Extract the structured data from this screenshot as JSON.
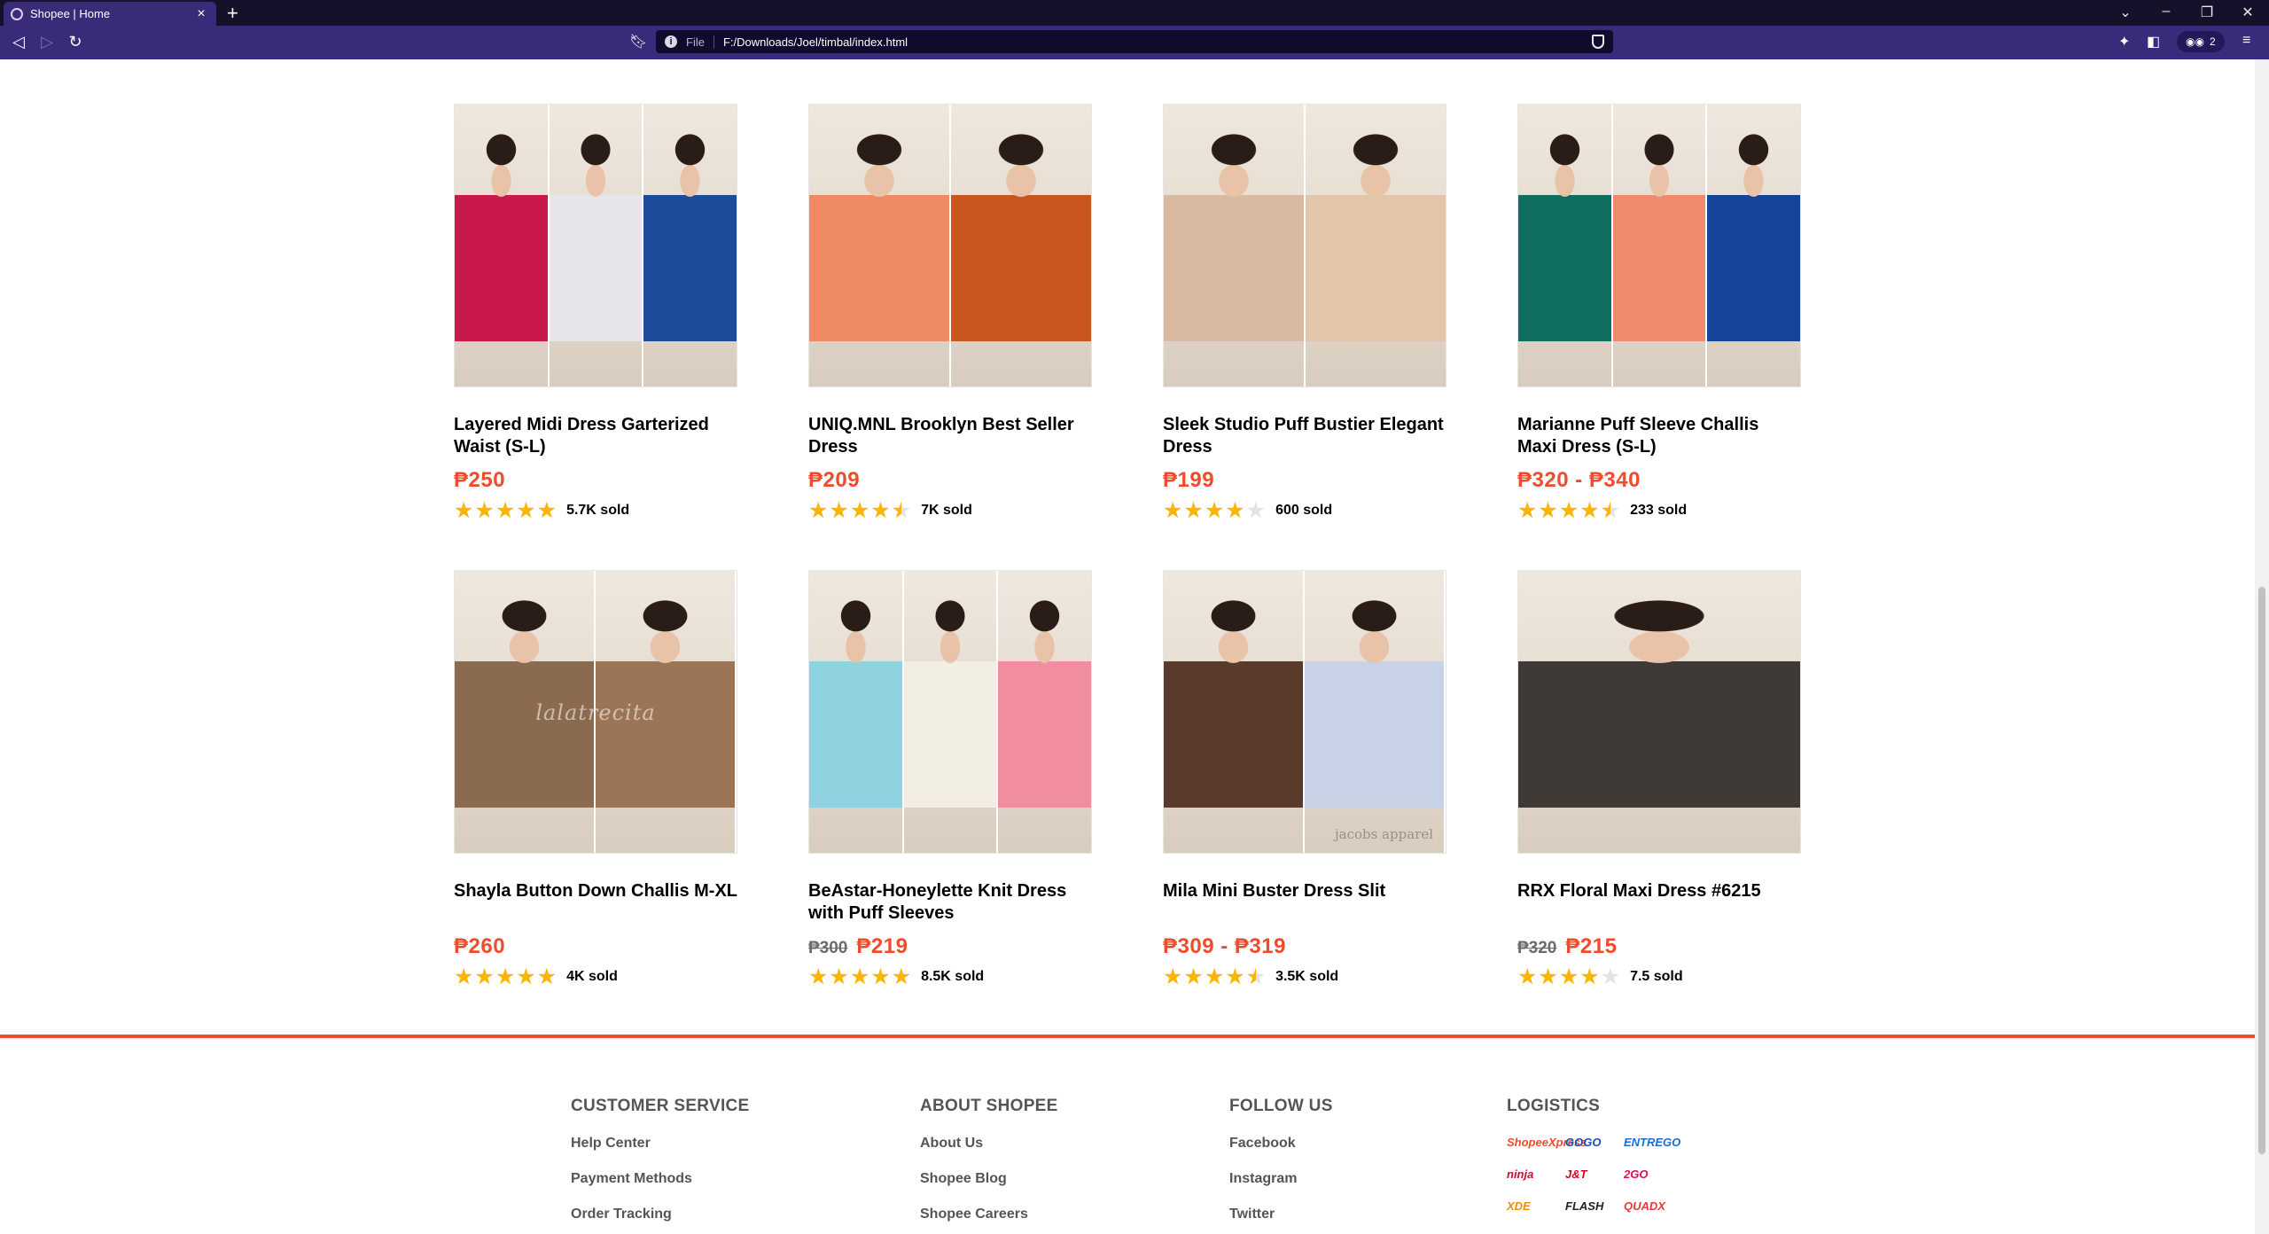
{
  "browser": {
    "tab_title": "Shopee | Home",
    "url_scheme": "File",
    "url": "F:/Downloads/Joel/timbal/index.html",
    "profile_count": "2"
  },
  "products": [
    {
      "title": "Layered Midi Dress Garterized Waist (S-L)",
      "old_price": "",
      "price": "₱250",
      "rating": 5,
      "sold": "5.7K sold",
      "image": {
        "panels": [
          "#c8194a",
          "#e6e6ea",
          "#1f4c9a"
        ],
        "watermark": "",
        "corner_mark": ""
      }
    },
    {
      "title": "UNIQ.MNL Brooklyn Best Seller Dress",
      "old_price": "",
      "price": "₱209",
      "rating": 4.5,
      "sold": "7K sold",
      "image": {
        "panels": [
          "#f08a64",
          "#c9561f"
        ],
        "watermark": "",
        "corner_mark": ""
      }
    },
    {
      "title": "Sleek Studio Puff Bustier Elegant Dress",
      "old_price": "",
      "price": "₱199",
      "rating": 4,
      "sold": "600 sold",
      "image": {
        "panels": [
          "#d9b9a0",
          "#e3c6aa"
        ],
        "watermark": "",
        "corner_mark": ""
      }
    },
    {
      "title": "Marianne Puff Sleeve Challis Maxi Dress (S-L)",
      "old_price": "",
      "price": "₱320 - ₱340",
      "rating": 4.5,
      "sold": "233 sold",
      "image": {
        "panels": [
          "#0f6e5f",
          "#f08a6e",
          "#17449a"
        ],
        "watermark": "",
        "corner_mark": ""
      }
    },
    {
      "title": "Shayla Button Down Challis M-XL",
      "old_price": "",
      "price": "₱260",
      "rating": 5,
      "sold": "4K sold",
      "image": {
        "panels": [
          "#8b6b50",
          "#9c7557"
        ],
        "watermark": "lalatrecita",
        "corner_mark": ""
      }
    },
    {
      "title": "BeAstar-Honeylette Knit Dress with Puff Sleeves",
      "old_price": "₱300",
      "price": "₱219",
      "rating": 5,
      "sold": "8.5K sold",
      "image": {
        "panels": [
          "#8fd3e0",
          "#f3eee4",
          "#f08ea0"
        ],
        "watermark": "",
        "corner_mark": ""
      }
    },
    {
      "title": "Mila Mini Buster Dress Slit",
      "old_price": "",
      "price": "₱309 - ₱319",
      "rating": 4.5,
      "sold": "3.5K sold",
      "image": {
        "panels": [
          "#5a3a2a",
          "#c7d2e6"
        ],
        "watermark": "",
        "corner_mark": "jacobs apparel"
      }
    },
    {
      "title": "RRX Floral Maxi Dress #6215",
      "old_price": "₱320",
      "price": "₱215",
      "rating": 4,
      "sold": "7.5 sold",
      "image": {
        "panels": [
          "#3f3a36"
        ],
        "watermark": "",
        "corner_mark": ""
      }
    }
  ],
  "footer": {
    "customer_service": {
      "title": "CUSTOMER SERVICE",
      "links": [
        "Help Center",
        "Payment Methods",
        "Order Tracking"
      ]
    },
    "about": {
      "title": "ABOUT SHOPEE",
      "links": [
        "About Us",
        "Shopee Blog",
        "Shopee Careers"
      ]
    },
    "follow": {
      "title": "FOLLOW US",
      "links": [
        "Facebook",
        "Instagram",
        "Twitter"
      ]
    },
    "logistics": {
      "title": "LOGISTICS",
      "logos": [
        {
          "name": "ShopeeXpress",
          "color": "#ee4d2d"
        },
        {
          "name": "GOGO",
          "color": "#1a4fc4"
        },
        {
          "name": "ENTREGO",
          "color": "#1a6fd4"
        },
        {
          "name": "ninja",
          "color": "#c8102e"
        },
        {
          "name": "J&T",
          "color": "#d0021b"
        },
        {
          "name": "2GO",
          "color": "#e30b5c"
        },
        {
          "name": "XDE",
          "color": "#f28c00"
        },
        {
          "name": "FLASH",
          "color": "#222222"
        },
        {
          "name": "QUADX",
          "color": "#e03a3a"
        }
      ]
    }
  },
  "colors": {
    "accent": "#ee4d2d",
    "star": "#ffb400",
    "chrome": "#3a2a7a"
  }
}
